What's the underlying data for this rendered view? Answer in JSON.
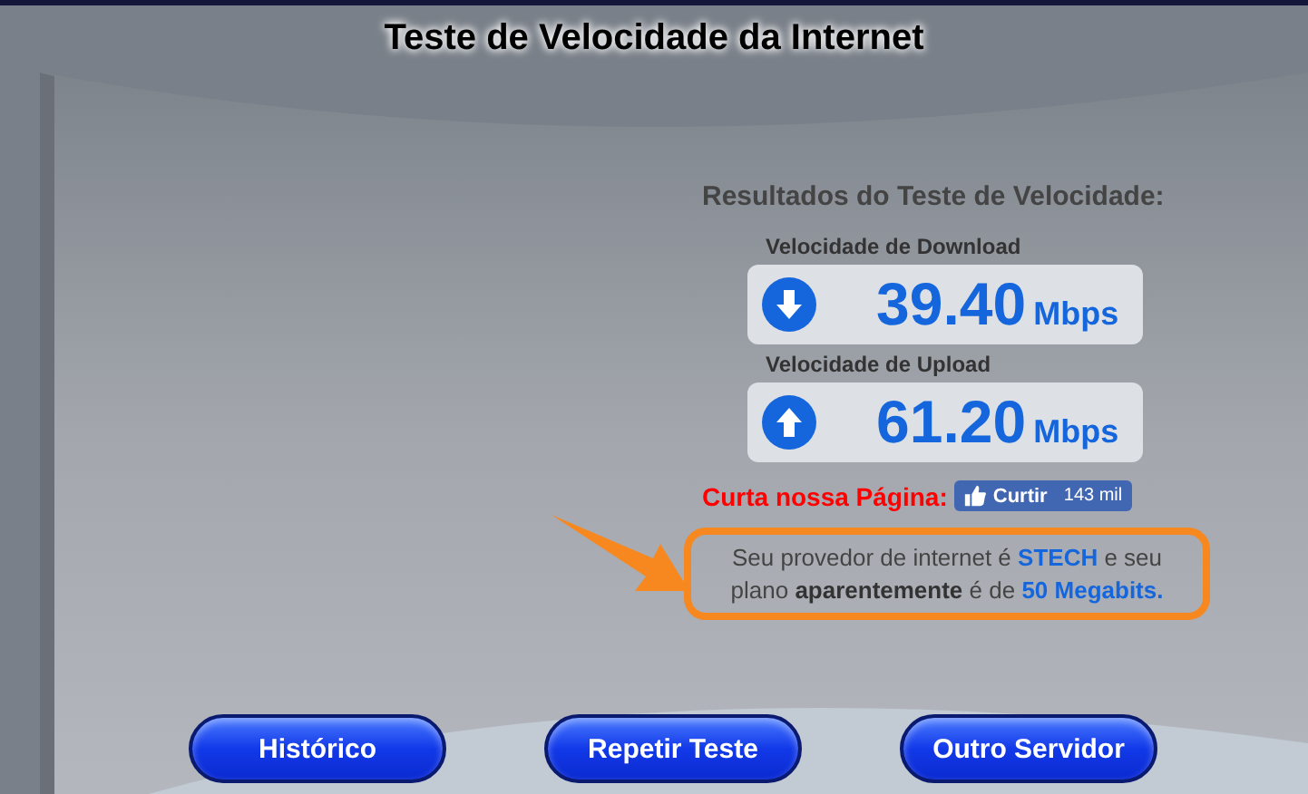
{
  "title": "Teste de Velocidade da Internet",
  "results": {
    "heading": "Resultados do Teste de Velocidade:",
    "items": [
      {
        "kind": "download",
        "label": "Velocidade de Download",
        "value": "39.40",
        "unit": "Mbps"
      },
      {
        "kind": "upload",
        "label": "Velocidade de Upload",
        "value": "61.20",
        "unit": "Mbps"
      }
    ]
  },
  "like": {
    "prompt": "Curta nossa Página:",
    "button": "Curtir",
    "count": "143 mil"
  },
  "provider_message": [
    {
      "kind": "plain",
      "text": "Seu provedor de internet é "
    },
    {
      "kind": "highlight",
      "text": "STECH"
    },
    {
      "kind": "plain",
      "text": " e seu plano "
    },
    {
      "kind": "strong",
      "text": "aparentemente"
    },
    {
      "kind": "plain",
      "text": " é de "
    },
    {
      "kind": "highlight",
      "text": "50 Megabits."
    }
  ],
  "buttons": [
    "Histórico",
    "Repetir Teste",
    "Outro Servidor"
  ]
}
